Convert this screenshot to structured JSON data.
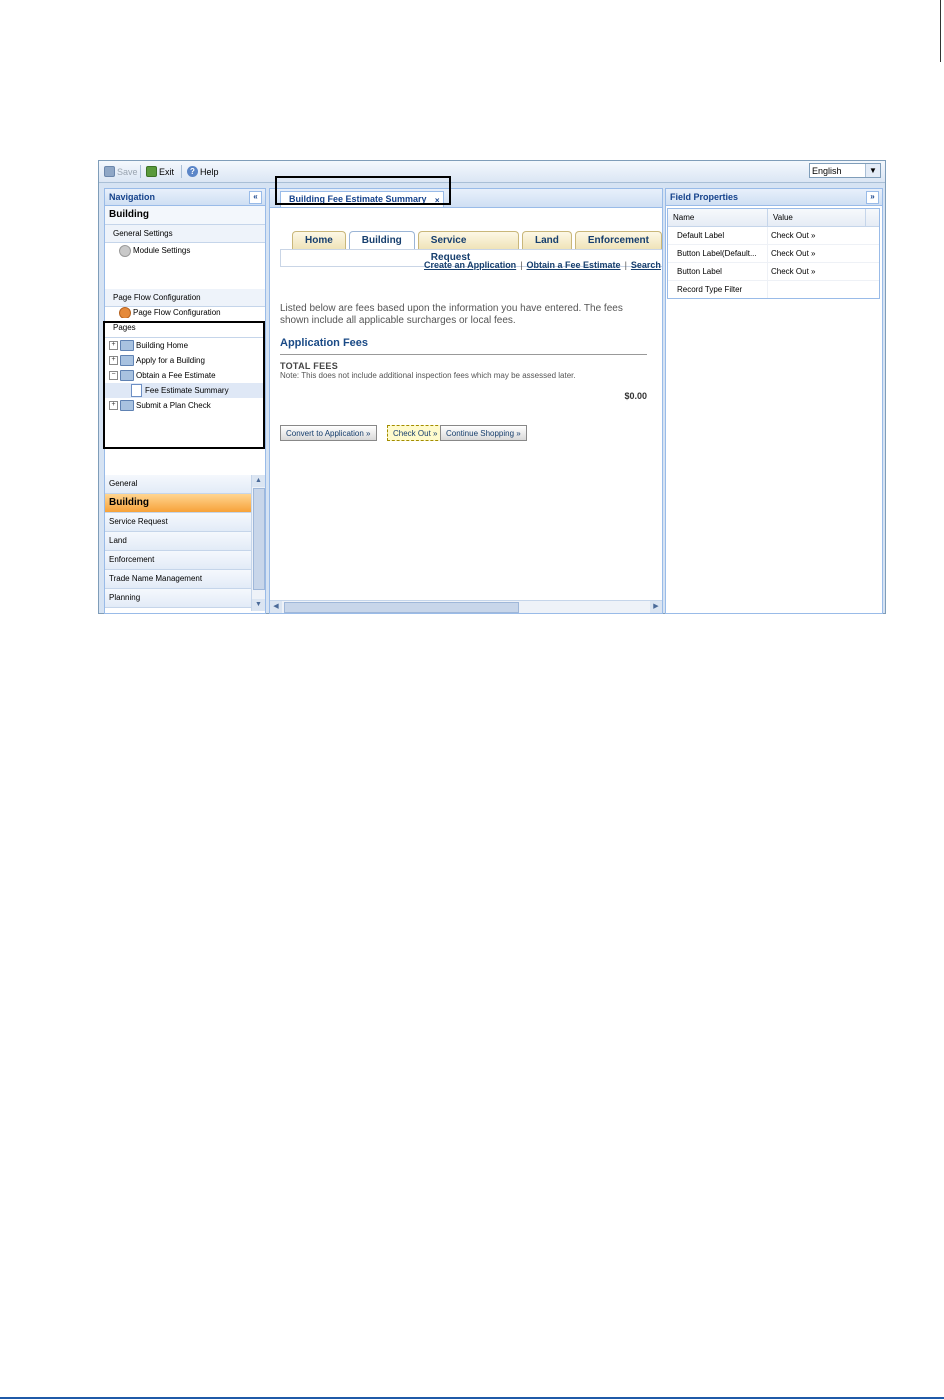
{
  "toolbar": {
    "save_label": "Save",
    "exit_label": "Exit",
    "help_label": "Help",
    "language_value": "English"
  },
  "navigation": {
    "title": "Navigation",
    "module": "Building",
    "general_settings_label": "General Settings",
    "module_settings_label": "Module Settings",
    "page_flow_section_label": "Page Flow Configuration",
    "page_flow_item_label": "Page Flow Configuration",
    "pages_label": "Pages",
    "pages": [
      {
        "label": "Building Home",
        "expander": "+"
      },
      {
        "label": "Apply for a Building",
        "expander": "+"
      },
      {
        "label": "Obtain a Fee Estimate",
        "expander": "−"
      },
      {
        "label": "Fee Estimate Summary",
        "expander": ""
      },
      {
        "label": "Submit a Plan Check",
        "expander": "+"
      }
    ],
    "modules": [
      "General",
      "Building",
      "Service Request",
      "Land",
      "Enforcement",
      "Trade Name Management",
      "Planning"
    ]
  },
  "center": {
    "doc_tab_label": "Building Fee Estimate Summary",
    "close_glyph": "×",
    "site_tabs": [
      "Home",
      "Building",
      "Service Request",
      "Land",
      "Enforcement"
    ],
    "sub_links": [
      "Create an Application",
      "Obtain a Fee Estimate",
      "Search"
    ],
    "intro_text": "Listed below are fees based upon the information you have entered. The fees shown include all applicable surcharges or local fees.",
    "fees_title": "Application Fees",
    "total_label": "TOTAL FEES",
    "total_note": "Note: This does not include additional inspection fees which may be assessed later.",
    "total_amount": "$0.00",
    "buttons": [
      "Convert to Application »",
      "Check Out »",
      "Continue Shopping »"
    ]
  },
  "field_properties": {
    "title": "Field Properties",
    "col_name": "Name",
    "col_value": "Value",
    "rows": [
      {
        "name": "Default Label",
        "value": "Check Out »"
      },
      {
        "name": "Button Label(Default...",
        "value": "Check Out »"
      },
      {
        "name": "Button Label",
        "value": "Check Out »"
      },
      {
        "name": "Record Type Filter",
        "value": ""
      }
    ]
  },
  "colors": {
    "accent": "#15428b",
    "active_module": "#f7a23a",
    "panel_border": "#99bbe8"
  }
}
